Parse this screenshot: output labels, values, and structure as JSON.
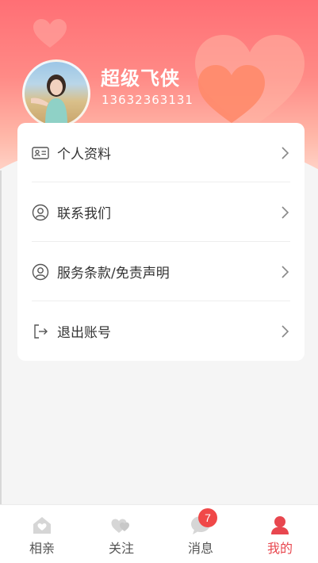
{
  "profile": {
    "name": "超级飞侠",
    "phone": "13632363131"
  },
  "menu": {
    "items": [
      {
        "label": "个人资料",
        "icon": "id-card-icon"
      },
      {
        "label": "联系我们",
        "icon": "user-circle-icon"
      },
      {
        "label": "服务条款/免责声明",
        "icon": "user-circle-icon"
      },
      {
        "label": "退出账号",
        "icon": "logout-icon"
      }
    ]
  },
  "tabbar": {
    "tabs": [
      {
        "label": "相亲",
        "icon": "home-heart-icon",
        "active": false
      },
      {
        "label": "关注",
        "icon": "hearts-icon",
        "active": false
      },
      {
        "label": "消息",
        "icon": "chat-icon",
        "active": false,
        "badge": "7"
      },
      {
        "label": "我的",
        "icon": "person-icon",
        "active": true
      }
    ]
  },
  "colors": {
    "accent": "#e8474f",
    "header_top": "#ff6f75",
    "header_bottom": "#ffd2c6",
    "badge": "#f04848"
  }
}
